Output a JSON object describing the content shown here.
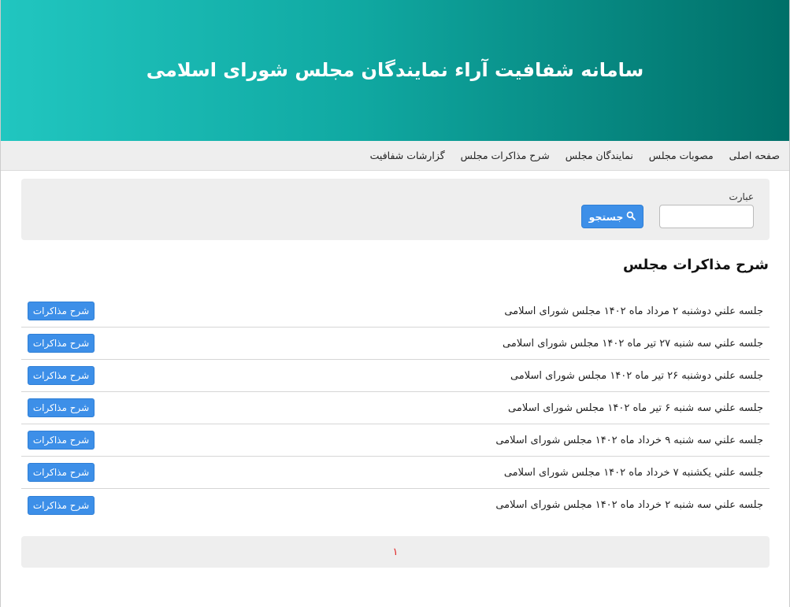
{
  "header": {
    "title": "سامانه شفافیت آراء نمایندگان مجلس شورای اسلامی"
  },
  "nav": {
    "items": [
      {
        "label": "صفحه اصلی"
      },
      {
        "label": "مصوبات مجلس"
      },
      {
        "label": "نمایندگان مجلس"
      },
      {
        "label": "شرح مذاکرات مجلس"
      },
      {
        "label": "گزارشات شفافیت"
      }
    ]
  },
  "search": {
    "label": "عبارت",
    "value": "",
    "button_label": "جستجو",
    "button_icon": "search-icon"
  },
  "section": {
    "title": "شرح مذاکرات مجلس"
  },
  "sessions": [
    {
      "title": "جلسه علني دوشنبه ۲ مرداد ماه ۱۴۰۲ مجلس شورای اسلامی",
      "button": "شرح مذاکرات"
    },
    {
      "title": "جلسه علني سه شنبه ۲۷ تير ماه ۱۴۰۲ مجلس شورای اسلامی",
      "button": "شرح مذاکرات"
    },
    {
      "title": "جلسه علني دوشنبه ۲۶ تير ماه ۱۴۰۲ مجلس شورای اسلامی",
      "button": "شرح مذاکرات"
    },
    {
      "title": "جلسه علني سه شنبه ۶ تير ماه ۱۴۰۲ مجلس شورای اسلامی",
      "button": "شرح مذاکرات"
    },
    {
      "title": "جلسه علني سه شنبه ۹ خرداد ماه ۱۴۰۲ مجلس شورای اسلامی",
      "button": "شرح مذاکرات"
    },
    {
      "title": "جلسه علني يكشنبه ۷ خرداد ماه ۱۴۰۲ مجلس شورای اسلامی",
      "button": "شرح مذاکرات"
    },
    {
      "title": "جلسه علني سه شنبه ۲ خرداد ماه ۱۴۰۲ مجلس شورای اسلامی",
      "button": "شرح مذاکرات"
    }
  ],
  "pagination": {
    "pages": [
      "۱"
    ],
    "current": "۱"
  },
  "colors": {
    "header_start": "#21c6c0",
    "header_end": "#006f68",
    "button": "#3d8fe8",
    "page_link": "#e02020"
  }
}
